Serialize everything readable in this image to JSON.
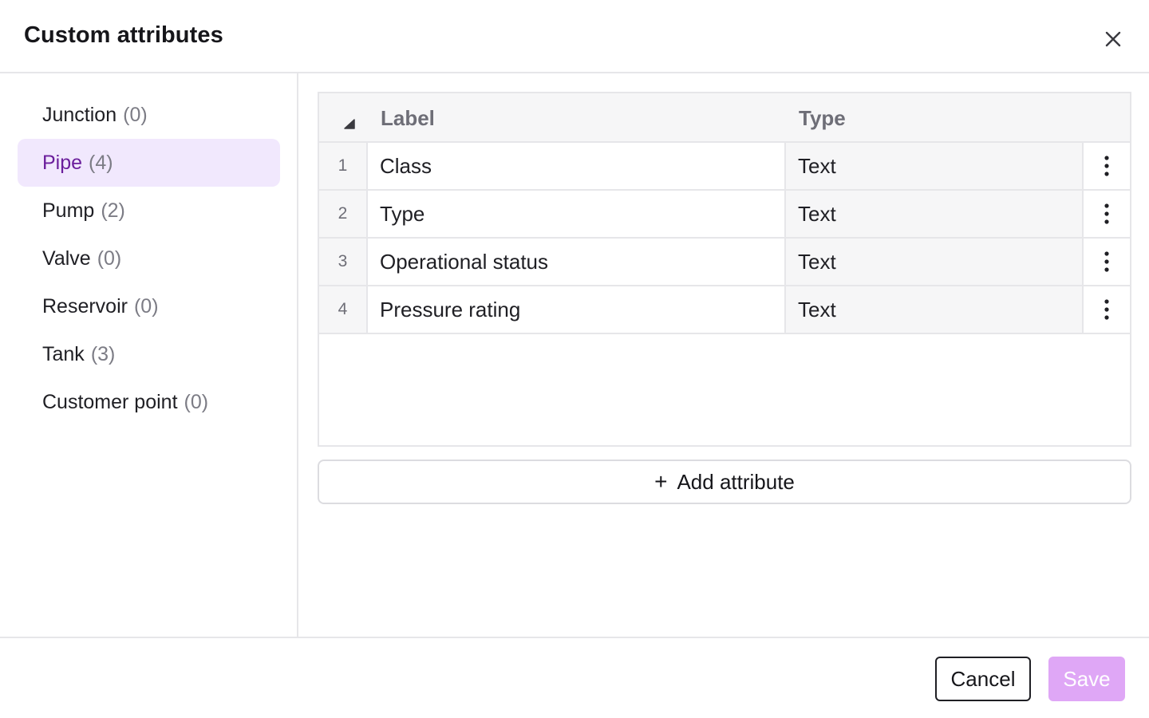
{
  "dialog": {
    "title": "Custom attributes",
    "close_icon": "close-icon"
  },
  "sidebar": {
    "items": [
      {
        "label": "Junction",
        "count": "(0)",
        "active": false
      },
      {
        "label": "Pipe",
        "count": "(4)",
        "active": true
      },
      {
        "label": "Pump",
        "count": "(2)",
        "active": false
      },
      {
        "label": "Valve",
        "count": "(0)",
        "active": false
      },
      {
        "label": "Reservoir",
        "count": "(0)",
        "active": false
      },
      {
        "label": "Tank",
        "count": "(3)",
        "active": false
      },
      {
        "label": "Customer point",
        "count": "(0)",
        "active": false
      }
    ]
  },
  "table": {
    "headers": {
      "label": "Label",
      "type": "Type"
    },
    "rows": [
      {
        "num": "1",
        "label": "Class",
        "type": "Text"
      },
      {
        "num": "2",
        "label": "Type",
        "type": "Text"
      },
      {
        "num": "3",
        "label": "Operational status",
        "type": "Text"
      },
      {
        "num": "4",
        "label": "Pressure rating",
        "type": "Text"
      }
    ]
  },
  "add_button": {
    "plus": "+",
    "label": "Add attribute"
  },
  "footer": {
    "cancel_label": "Cancel",
    "save_label": "Save"
  },
  "colors": {
    "accent": "#6b1e9c",
    "active_bg": "#f1e8fd",
    "save_disabled": "#dfa7f6"
  }
}
